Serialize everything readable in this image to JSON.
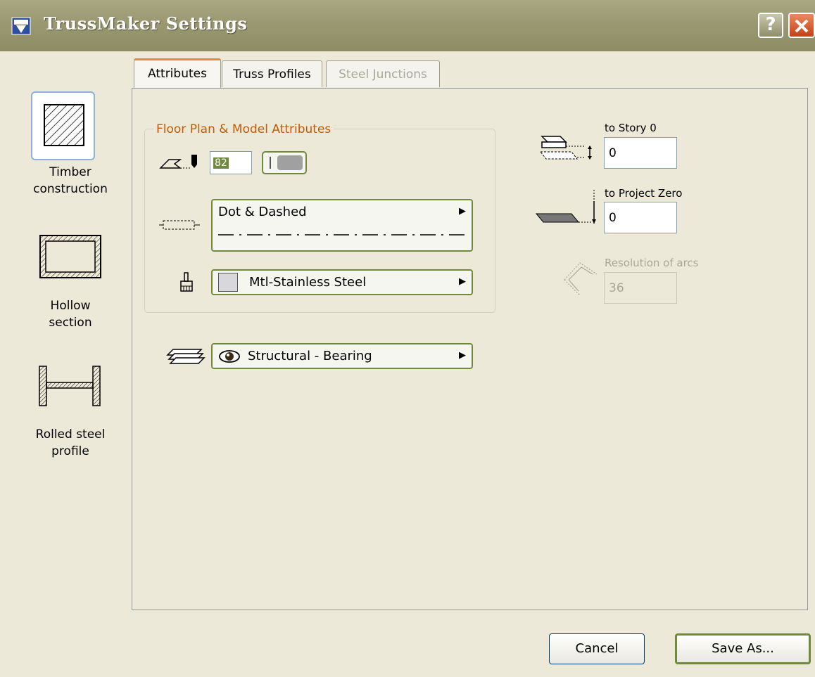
{
  "window": {
    "title": "TrussMaker Settings"
  },
  "sidebar": {
    "items": [
      {
        "label_line1": "Timber",
        "label_line2": "construction"
      },
      {
        "label_line1": "Hollow",
        "label_line2": "section"
      },
      {
        "label_line1": "Rolled steel",
        "label_line2": "profile"
      }
    ]
  },
  "tabs": [
    {
      "label": "Attributes",
      "state": "active"
    },
    {
      "label": "Truss Profiles",
      "state": "normal"
    },
    {
      "label": "Steel Junctions",
      "state": "disabled"
    }
  ],
  "attributes": {
    "group_title": "Floor Plan & Model Attributes",
    "pen_value": "82",
    "line_type": "Dot & Dashed",
    "material": "Mtl-Stainless Steel",
    "layer": "Structural - Bearing"
  },
  "elevation": {
    "story_label": "to Story 0",
    "story_value": "0",
    "project_zero_label": "to Project Zero",
    "project_zero_value": "0",
    "resolution_label": "Resolution of arcs",
    "resolution_value": "36"
  },
  "buttons": {
    "cancel": "Cancel",
    "save_as": "Save As..."
  },
  "colors": {
    "group_title": "#c05a06",
    "active_tab_accent": "#e68b2c",
    "titlebar": "#9b9a73"
  },
  "icons": [
    "app-icon",
    "help-icon",
    "close-icon",
    "pen-icon",
    "line-type-icon",
    "material-brush-icon",
    "layer-icon",
    "eye-icon",
    "story-elevation-icon",
    "project-zero-icon",
    "arc-resolution-icon",
    "timber-hatch-icon",
    "hollow-section-icon",
    "rolled-steel-icon"
  ]
}
